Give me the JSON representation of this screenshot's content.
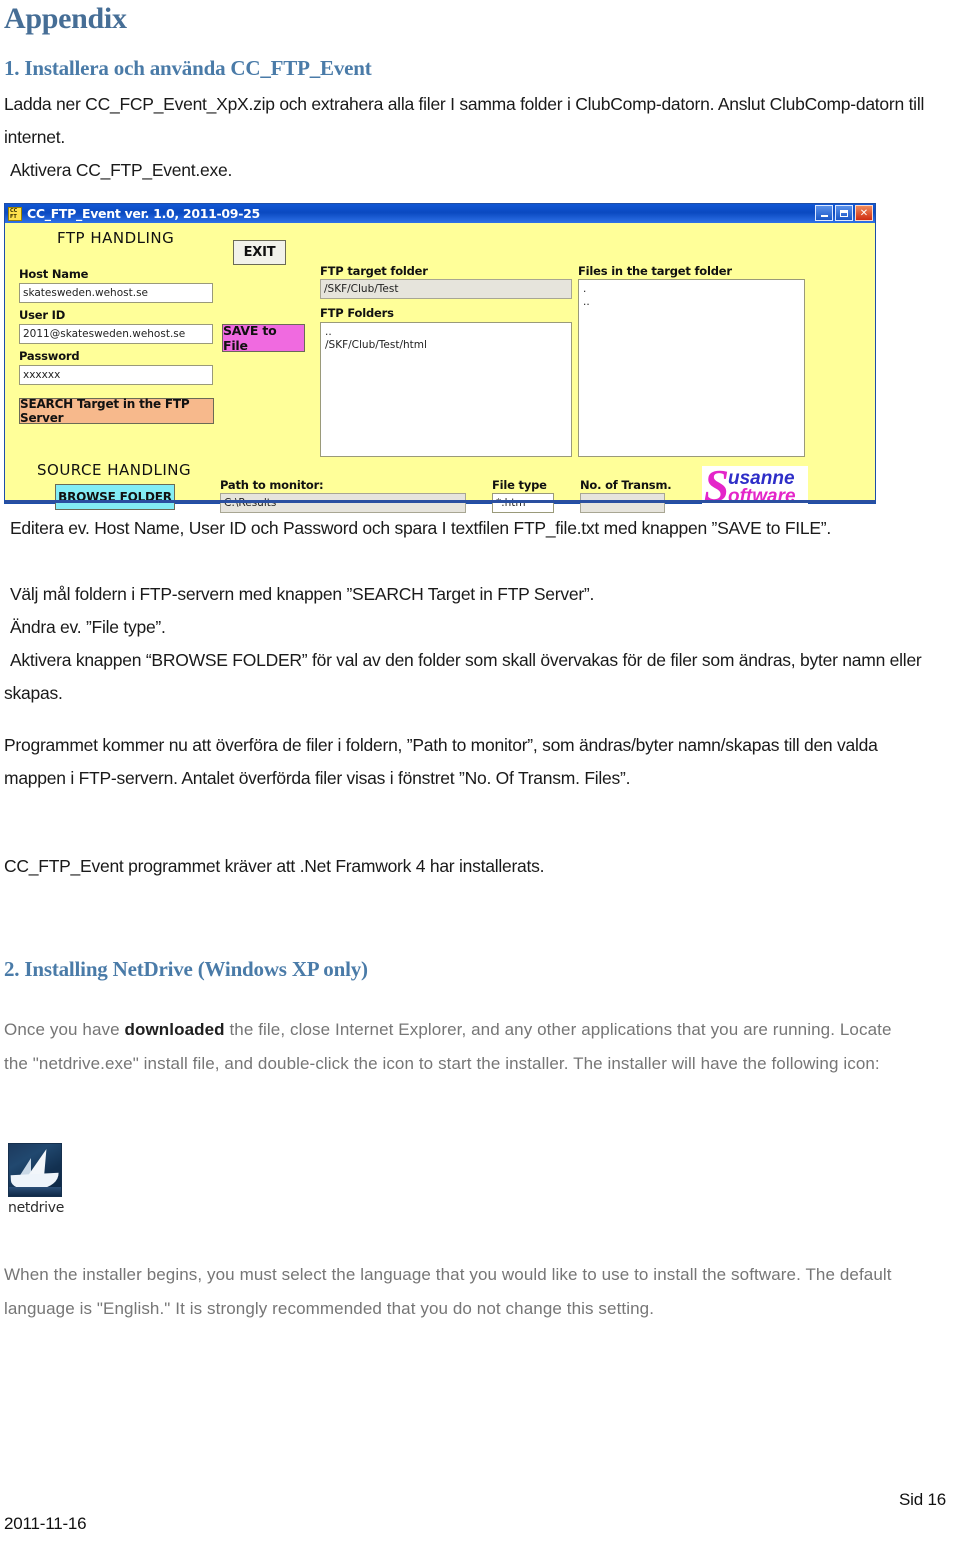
{
  "document": {
    "appendix_title": "Appendix",
    "section1": {
      "heading": "1. Installera och använda CC_FTP_Event",
      "para1": "Ladda ner CC_FCP_Event_XpX.zip och extrahera alla filer I samma folder i ClubComp-datorn. Anslut ClubComp-datorn till internet.",
      "para2": "Aktivera CC_FTP_Event.exe.",
      "para3": "Editera ev. Host Name, User ID och Password och spara I textfilen FTP_file.txt med knappen ”SAVE to FILE”.",
      "para4": "Välj mål foldern i FTP-servern med knappen ”SEARCH Target in FTP Server”.",
      "para5": "Ändra ev. ”File type”.",
      "para6": "Aktivera knappen “BROWSE FOLDER” för val av den folder som skall övervakas för de filer som ändras, byter namn eller skapas.",
      "para7": "Programmet kommer nu att överföra de filer i foldern, ”Path to monitor”, som ändras/byter namn/skapas till den valda mappen i FTP-servern. Antalet överförda filer visas i fönstret ”No. Of Transm. Files”.",
      "para8": "CC_FTP_Event programmet kräver att .Net Framwork 4 har installerats."
    },
    "section2": {
      "heading": "2. Installing NetDrive (Windows XP only)",
      "para1_before": "Once you have ",
      "para1_bold": "downloaded",
      "para1_after": " the file, close Internet Explorer, and any other applications that you are running. Locate the \"netdrive.exe\" install file, and double-click the icon to start the installer. The installer will have the following icon:",
      "icon_label": "netdrive",
      "para2": "When the installer begins, you must select the language that you would like to use to install the software. The default language is \"English.\" It is strongly recommended that you do not change this setting."
    },
    "footer": {
      "page_label": "Sid 16",
      "date": "2011-11-16"
    }
  },
  "app_window": {
    "titlebar": {
      "icon_line1": "CC",
      "icon_line2": "FT",
      "title": "CC_FTP_Event ver. 1.0, 2011-09-25",
      "minimize_label": "_",
      "maximize_label": "□",
      "close_label": "✕"
    },
    "ftp_handling": {
      "section_title": "FTP HANDLING",
      "host_name_label": "Host Name",
      "host_name_value": "skatesweden.wehost.se",
      "user_id_label": "User ID",
      "user_id_value": "2011@skatesweden.wehost.se",
      "password_label": "Password",
      "password_value": "xxxxxx",
      "exit_button": "EXIT",
      "save_button": "SAVE to File",
      "search_button": "SEARCH Target in the FTP Server"
    },
    "ftp_target": {
      "target_folder_label": "FTP target folder",
      "target_folder_value": "/SKF/Club/Test",
      "folders_label": "FTP Folders",
      "folders_items": [
        "..",
        "/SKF/Club/Test/html"
      ]
    },
    "target_files": {
      "label": "Files in the target folder",
      "items": [
        ".",
        ".."
      ]
    },
    "source_handling": {
      "section_title": "SOURCE HANDLING",
      "browse_button": "BROWSE FOLDER",
      "path_label": "Path to monitor:",
      "path_value": "C:\\Results",
      "file_type_label": "File type",
      "file_type_value": "*.htm",
      "transm_label": "No. of Transm.",
      "transm_value": ""
    },
    "logo": {
      "initial": "S",
      "word1": "usanne",
      "word2": "oftware"
    },
    "colors": {
      "window_background": "#ffff99",
      "titlebar": "#0a49c0",
      "save_button": "#f06ae0",
      "search_button": "#f7b98c",
      "browse_button": "#83edf5",
      "heading_blue": "#4a7ba8"
    }
  }
}
